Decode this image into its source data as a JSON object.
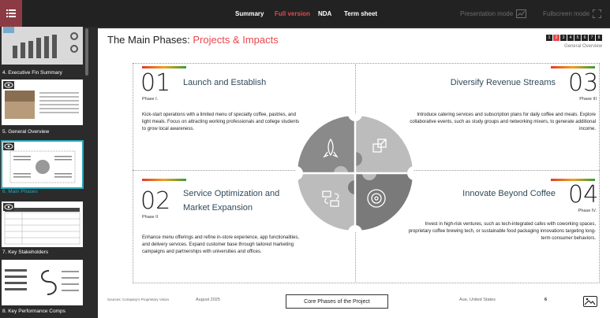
{
  "topbar": {
    "menu_icon": "hamburger-menu-icon",
    "tabs": [
      {
        "label": "Summary",
        "active": false
      },
      {
        "label": "Full version",
        "active": true
      },
      {
        "label": "NDA",
        "active": false
      },
      {
        "label": "Term sheet",
        "active": false
      }
    ],
    "presentation_mode": "Presentation mode",
    "fullscreen_mode": "Fullscreen mode",
    "accent_color": "#e8474d"
  },
  "sidebar": {
    "items": [
      {
        "label": "4. Executive Fin Summary"
      },
      {
        "label": "5. General Overview"
      },
      {
        "label": "6. Main Phases",
        "active": true
      },
      {
        "label": "7. Key Stakeholders"
      },
      {
        "label": "8. Key Performance Comps"
      }
    ]
  },
  "slide": {
    "title_prefix": "The Main Phases: ",
    "title_highlight": "Projects & Impacts",
    "pages": [
      "1",
      "2",
      "3",
      "4",
      "5",
      "6",
      "7",
      "8"
    ],
    "current_page": "2",
    "section_label": "General Overview",
    "phases": [
      {
        "number": "01",
        "phase_label": "Phase I.",
        "title": "Launch and Establish",
        "description": "Kick-start operations with a limited menu of specialty coffee, pastries, and light meals. Focus on attracting working professionals and college students to grow local awareness."
      },
      {
        "number": "03",
        "phase_label": "Phase III",
        "title": "Diversify Revenue Streams",
        "description": "Introduce catering services and subscription plans for daily coffee and meals. Explore collaborative events, such as study groups and networking mixers, to generate additional income."
      },
      {
        "number": "02",
        "phase_label": "Phase II",
        "title_line1": "Service Optimization and",
        "title_line2": "Market Expansion",
        "description": "Enhance menu offerings and refine in-store experience, app functionalities, and delivery services. Expand customer base through tailored marketing campaigns and partnerships with universities and offices."
      },
      {
        "number": "04",
        "phase_label": "Phase IV.",
        "title": "Innovate Beyond Coffee",
        "description": "Invest in high-risk ventures, such as tech-integrated cafes with coworking spaces, proprietary coffee brewing tech, or sustainable food packaging innovations targeting long-term consumer behaviors."
      }
    ],
    "puzzle_icons": [
      "rocket-icon",
      "expand-squares-icon",
      "cycle-arrows-icon",
      "target-icon"
    ],
    "footer": {
      "source": "Sources: Company's Proprietary Vision",
      "date": "August 2025",
      "center_label": "Core Phases of the Project",
      "location": "Aue, United States",
      "page_number": "6"
    }
  }
}
